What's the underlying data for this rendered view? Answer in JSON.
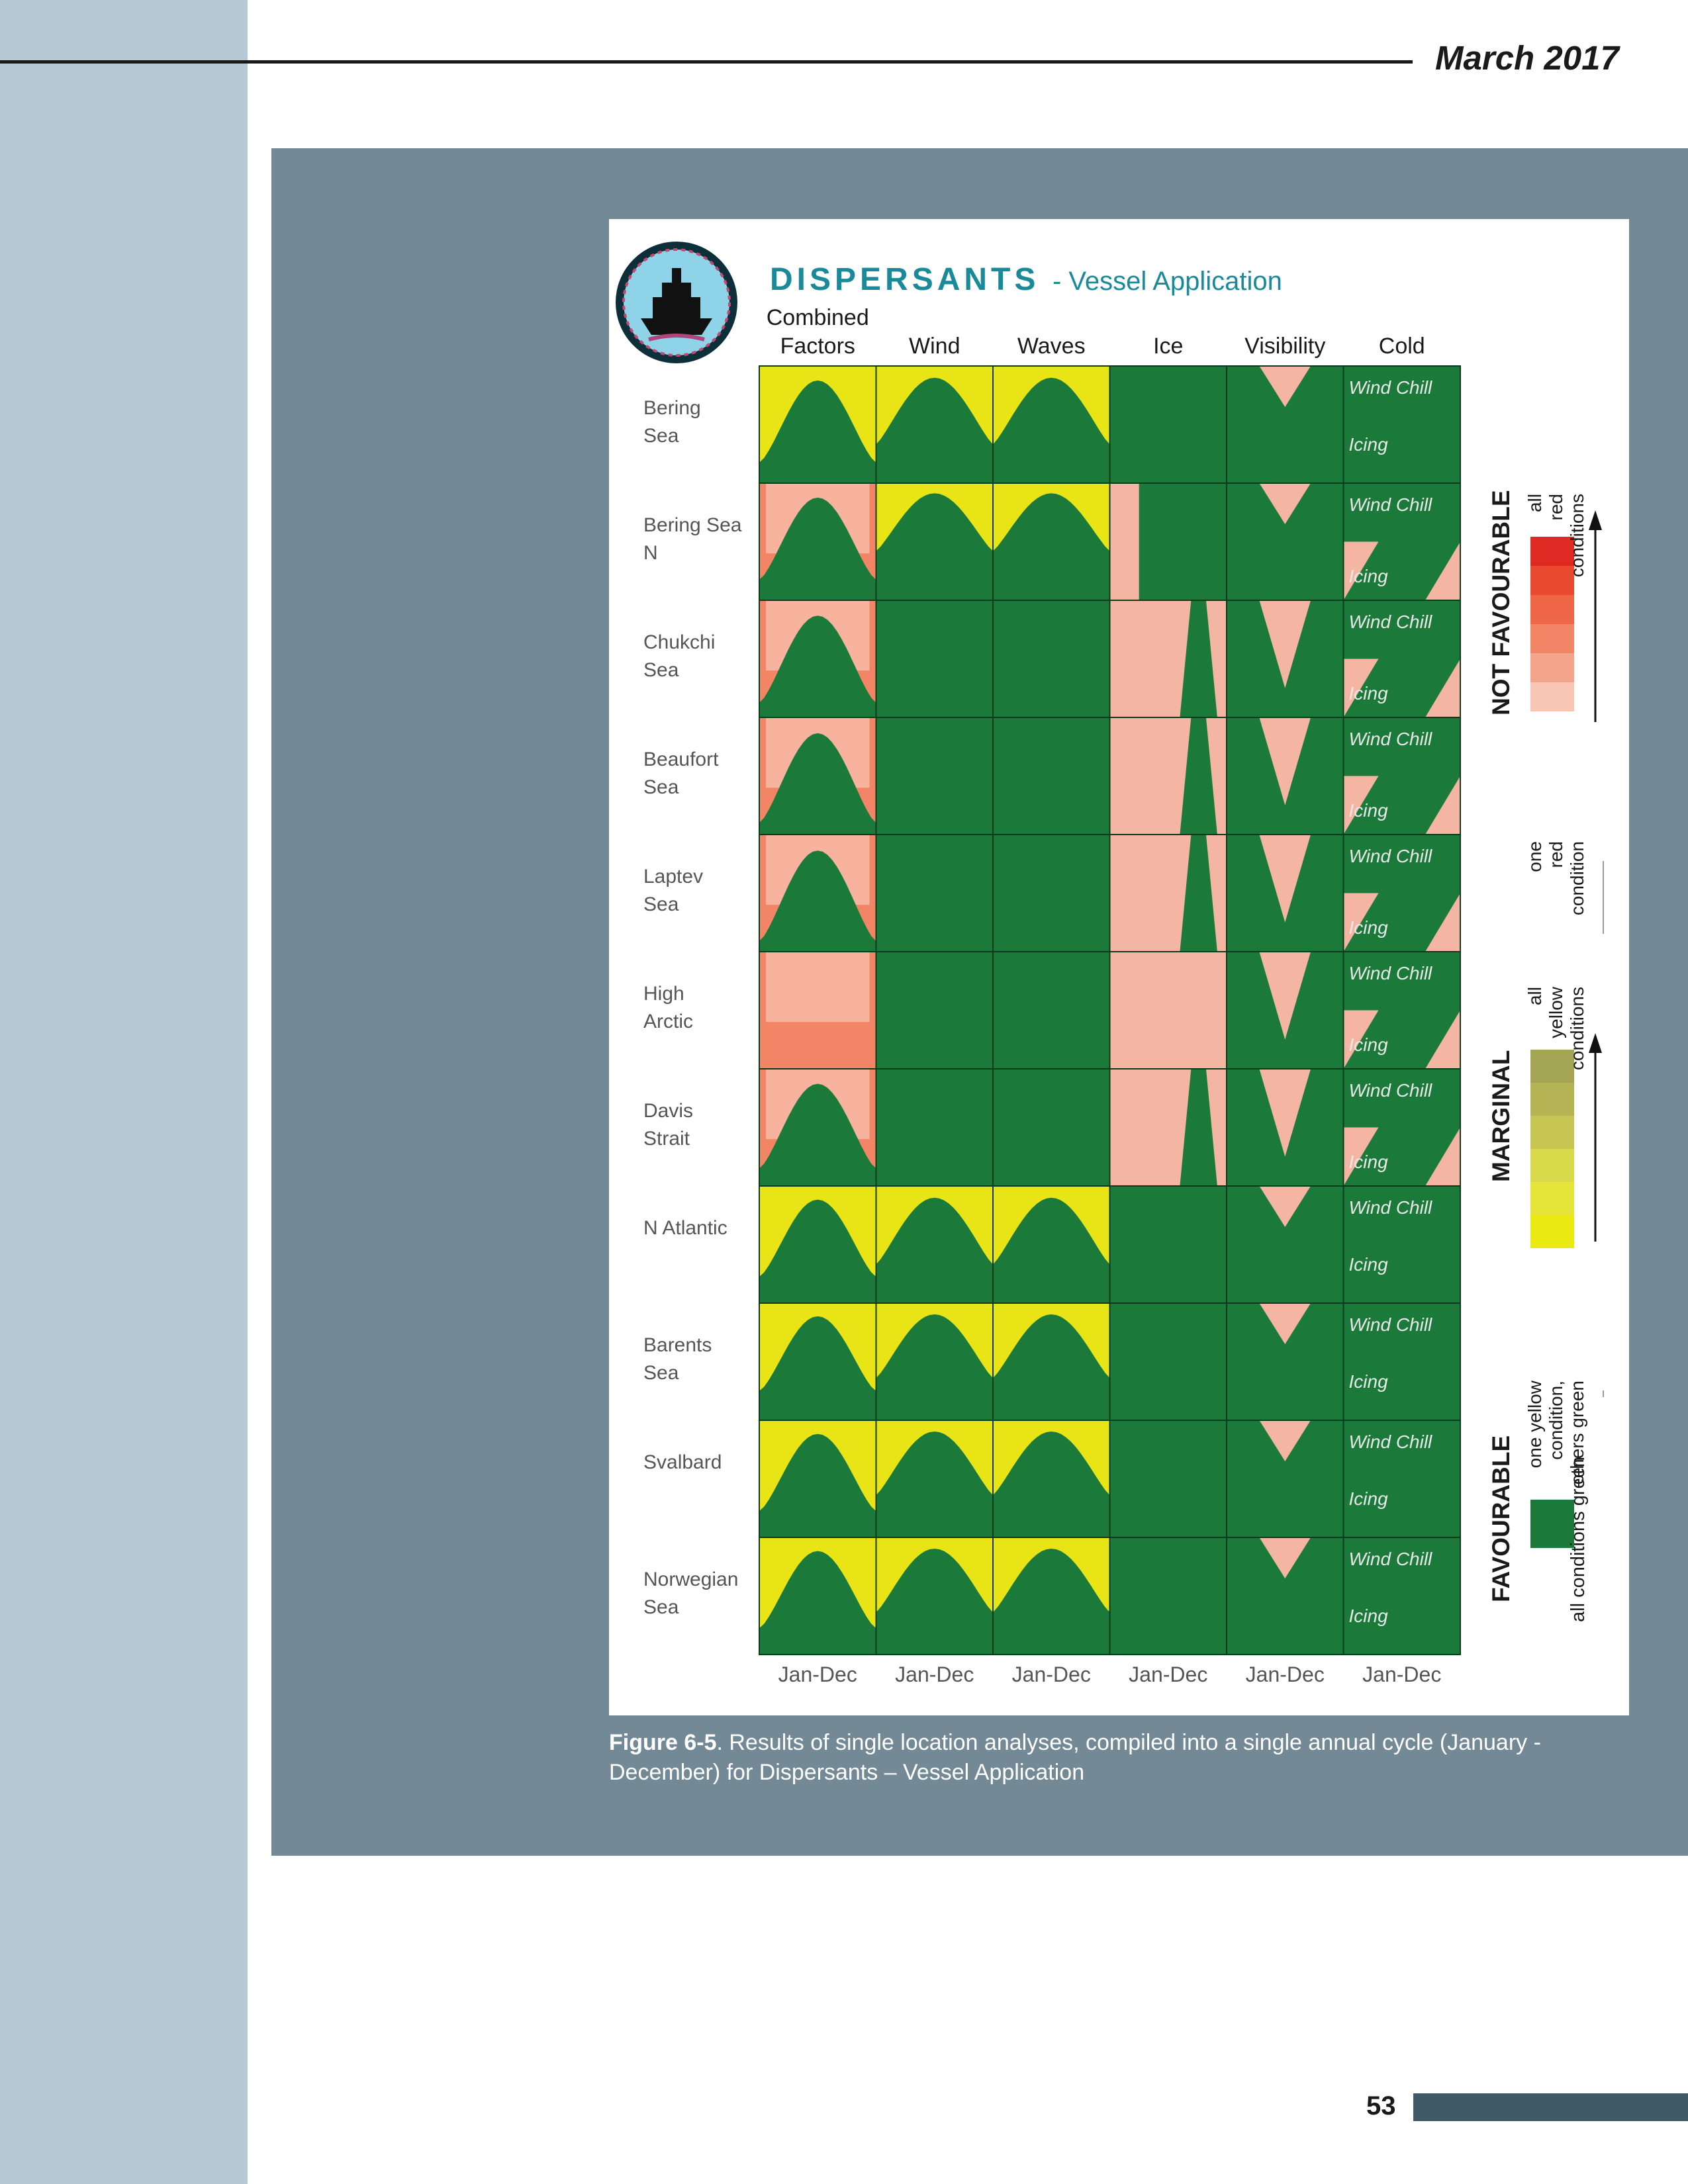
{
  "header": {
    "date": "March 2017"
  },
  "figure": {
    "title_main": "DISPERSANTS",
    "title_sub": "- Vessel Application",
    "columns": [
      {
        "line1": "Combined",
        "line2": "Factors"
      },
      {
        "line1": "",
        "line2": "Wind"
      },
      {
        "line1": "",
        "line2": "Waves"
      },
      {
        "line1": "",
        "line2": "Ice"
      },
      {
        "line1": "",
        "line2": "Visibility"
      },
      {
        "line1": "",
        "line2": "Cold"
      }
    ],
    "rows": [
      {
        "line1": "Bering",
        "line2": "Sea"
      },
      {
        "line1": "Bering Sea",
        "line2": "N"
      },
      {
        "line1": "Chukchi",
        "line2": "Sea"
      },
      {
        "line1": "Beaufort",
        "line2": "Sea"
      },
      {
        "line1": "Laptev",
        "line2": "Sea"
      },
      {
        "line1": "High",
        "line2": "Arctic"
      },
      {
        "line1": "Davis",
        "line2": "Strait"
      },
      {
        "line1": "N Atlantic",
        "line2": ""
      },
      {
        "line1": "Barents",
        "line2": "Sea"
      },
      {
        "line1": "Svalbard",
        "line2": ""
      },
      {
        "line1": "Norwegian",
        "line2": "Sea"
      }
    ],
    "cold_labels": {
      "top": "Wind Chill",
      "bottom": "Icing"
    },
    "x_label": "Jan-Dec",
    "legend": {
      "not_favourable": "NOT FAVOURABLE",
      "marginal": "MARGINAL",
      "favourable": "FAVOURABLE",
      "nf_top": [
        "all",
        "red",
        "conditions"
      ],
      "nf_bottom": [
        "one",
        "red",
        "condition"
      ],
      "mg_top": [
        "all",
        "yellow",
        "conditions"
      ],
      "mg_bottom": [
        "one yellow",
        "condition,",
        "others green"
      ],
      "fav": "all conditions green"
    },
    "colors": {
      "green": "#1b7a3a",
      "yellow": "#e8e416",
      "pink": "#f5b5a3",
      "red_scale": [
        "#f9c6b6",
        "#f5a48c",
        "#f28566",
        "#ee6646",
        "#ea4a30",
        "#df2a24"
      ],
      "yellow_scale": [
        "#eaea10",
        "#e6e63a",
        "#d9d94c",
        "#c7c654",
        "#b5b455",
        "#a3a454"
      ]
    }
  },
  "caption": {
    "label": "Figure 6-5",
    "text": ". Results of single location analyses, compiled into a single annual cycle (January - December) for Dispersants – Vessel Application"
  },
  "page_number": "53"
}
